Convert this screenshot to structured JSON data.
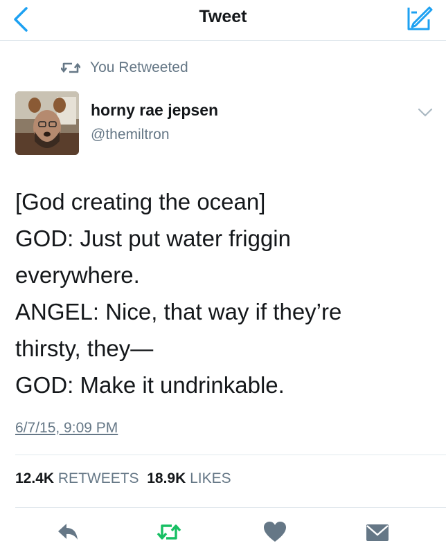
{
  "nav": {
    "title": "Tweet"
  },
  "retweet_context": {
    "label": "You Retweeted"
  },
  "author": {
    "name": "horny rae jepsen",
    "handle": "@themiltron"
  },
  "tweet": {
    "lines": [
      "[God creating the ocean]",
      "GOD: Just put water friggin",
      "everywhere.",
      "ANGEL: Nice, that way if they’re",
      "thirsty, they—",
      "GOD: Make it undrinkable."
    ],
    "timestamp": "6/7/15, 9:09 PM"
  },
  "stats": {
    "retweets_count": "12.4K",
    "retweets_label": "RETWEETS",
    "likes_count": "18.9K",
    "likes_label": "LIKES"
  },
  "colors": {
    "accent": "#1da1f2",
    "retweet_green": "#17bf63",
    "secondary_text": "#657786",
    "icon_gray": "#657786"
  },
  "icons": [
    "back-chevron-icon",
    "compose-icon",
    "retweet-icon",
    "caret-down-icon",
    "reply-icon",
    "retweet-icon",
    "heart-icon",
    "direct-message-icon"
  ]
}
